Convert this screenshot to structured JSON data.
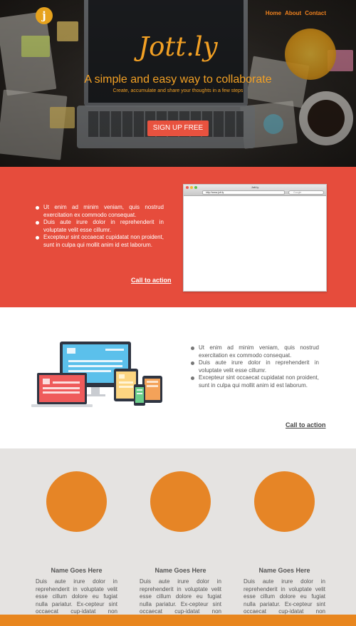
{
  "hero": {
    "logo_letter": "j",
    "nav": [
      "Home",
      "About",
      "Contact"
    ],
    "brand": "Jott.ly",
    "tagline": "A simple and easy way to collaborate",
    "subtagline": "Create, accumulate and share your thoughts in a few steps",
    "signup_label": "SIGN UP FREE"
  },
  "feature1": {
    "bullets": [
      "Ut enim ad minim veniam, quis nostrud exercitation ex commodo consequat.",
      "Duis aute irure dolor in reprehenderit in voluptate velit esse cillumr.",
      "Excepteur sint occaecat cupidatat non proident, sunt in culpa qui mollit anim id est laborum."
    ],
    "cta": "Call to action",
    "browser": {
      "title": "Jott.ly",
      "url": "http://www.jott.ly",
      "search_placeholder": "Google"
    }
  },
  "feature2": {
    "bullets": [
      "Ut enim ad minim veniam, quis nostrud exercitation ex commodo consequat.",
      "Duis aute irure dolor in reprehenderit in voluptate velit esse cillumr.",
      "Excepteur sint occaecat cupidatat non proident, sunt in culpa qui mollit anim id est laborum."
    ],
    "cta": "Call to action"
  },
  "team": [
    {
      "name": "Name Goes Here",
      "bio": "Duis aute irure dolor in reprehenderit in voluptate velit esse cillum dolore eu fugiat nulla pariatur. Ex-cepteur sint occaecat cup-idatat non proident."
    },
    {
      "name": "Name Goes Here",
      "bio": "Duis aute irure dolor in reprehenderit in voluptate velit esse cillum dolore eu fugiat nulla pariatur. Ex-cepteur sint occaecat cup-idatat non proident."
    },
    {
      "name": "Name Goes Here",
      "bio": "Duis aute irure dolor in reprehenderit in voluptate velit esse cillum dolore eu fugiat nulla pariatur. Ex-cepteur sint occaecat cup-idatat non proident."
    }
  ],
  "colors": {
    "accent_orange": "#f2a024",
    "red_section": "#e64c3c",
    "gray_section": "#e5e3e1",
    "avatar_orange": "#e68526"
  }
}
